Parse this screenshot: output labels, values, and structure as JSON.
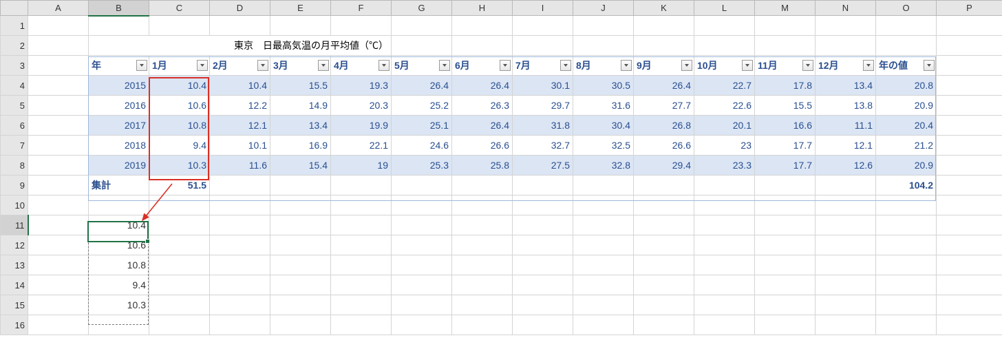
{
  "title": "東京　日最高気温の月平均値（℃）",
  "columns": [
    "A",
    "B",
    "C",
    "D",
    "E",
    "F",
    "G",
    "H",
    "I",
    "J",
    "K",
    "L",
    "M",
    "N",
    "O",
    "P"
  ],
  "row_numbers": [
    1,
    2,
    3,
    4,
    5,
    6,
    7,
    8,
    9,
    10,
    11,
    12,
    13,
    14,
    15,
    16
  ],
  "table": {
    "headers": [
      "年",
      "1月",
      "2月",
      "3月",
      "4月",
      "5月",
      "6月",
      "7月",
      "8月",
      "9月",
      "10月",
      "11月",
      "12月",
      "年の値"
    ],
    "rows": [
      {
        "year": "2015",
        "v": [
          "10.4",
          "10.4",
          "15.5",
          "19.3",
          "26.4",
          "26.4",
          "30.1",
          "30.5",
          "26.4",
          "22.7",
          "17.8",
          "13.4",
          "20.8"
        ]
      },
      {
        "year": "2016",
        "v": [
          "10.6",
          "12.2",
          "14.9",
          "20.3",
          "25.2",
          "26.3",
          "29.7",
          "31.6",
          "27.7",
          "22.6",
          "15.5",
          "13.8",
          "20.9"
        ]
      },
      {
        "year": "2017",
        "v": [
          "10.8",
          "12.1",
          "13.4",
          "19.9",
          "25.1",
          "26.4",
          "31.8",
          "30.4",
          "26.8",
          "20.1",
          "16.6",
          "11.1",
          "20.4"
        ]
      },
      {
        "year": "2018",
        "v": [
          "9.4",
          "10.1",
          "16.9",
          "22.1",
          "24.6",
          "26.6",
          "32.7",
          "32.5",
          "26.6",
          "23",
          "17.7",
          "12.1",
          "21.2"
        ]
      },
      {
        "year": "2019",
        "v": [
          "10.3",
          "11.6",
          "15.4",
          "19",
          "25.3",
          "25.8",
          "27.5",
          "32.8",
          "29.4",
          "23.3",
          "17.7",
          "12.6",
          "20.9"
        ]
      }
    ],
    "totals_label": "集計",
    "totals": {
      "jan_sum": "51.5",
      "year_sum": "104.2"
    }
  },
  "copied_values": [
    "10.4",
    "10.6",
    "10.8",
    "9.4",
    "10.3"
  ],
  "chart_data": {
    "type": "table",
    "title": "東京　日最高気温の月平均値（℃）",
    "columns": [
      "年",
      "1月",
      "2月",
      "3月",
      "4月",
      "5月",
      "6月",
      "7月",
      "8月",
      "9月",
      "10月",
      "11月",
      "12月",
      "年の値"
    ],
    "rows": [
      [
        "2015",
        10.4,
        10.4,
        15.5,
        19.3,
        26.4,
        26.4,
        30.1,
        30.5,
        26.4,
        22.7,
        17.8,
        13.4,
        20.8
      ],
      [
        "2016",
        10.6,
        12.2,
        14.9,
        20.3,
        25.2,
        26.3,
        29.7,
        31.6,
        27.7,
        22.6,
        15.5,
        13.8,
        20.9
      ],
      [
        "2017",
        10.8,
        12.1,
        13.4,
        19.9,
        25.1,
        26.4,
        31.8,
        30.4,
        26.8,
        20.1,
        16.6,
        11.1,
        20.4
      ],
      [
        "2018",
        9.4,
        10.1,
        16.9,
        22.1,
        24.6,
        26.6,
        32.7,
        32.5,
        26.6,
        23.0,
        17.7,
        12.1,
        21.2
      ],
      [
        "2019",
        10.3,
        11.6,
        15.4,
        19.0,
        25.3,
        25.8,
        27.5,
        32.8,
        29.4,
        23.3,
        17.7,
        12.6,
        20.9
      ]
    ],
    "totals": {
      "label": "集計",
      "1月": 51.5,
      "年の値": 104.2
    }
  }
}
